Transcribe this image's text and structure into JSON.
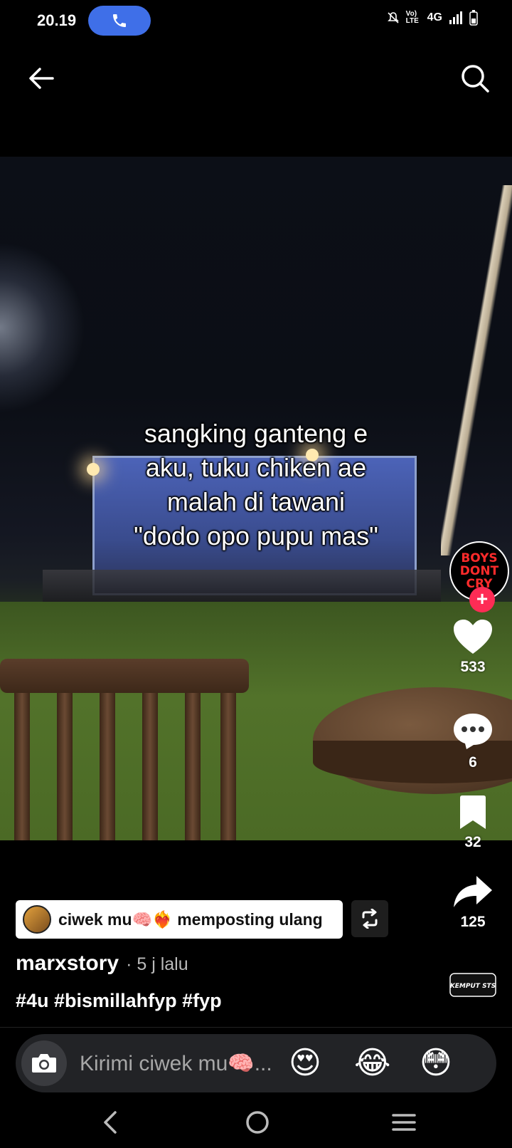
{
  "status_bar": {
    "time": "20.19",
    "network": "4G",
    "volte": "Vo) LTE"
  },
  "top_bar": {
    "back_icon": "arrow-left-icon",
    "search_icon": "search-icon"
  },
  "video": {
    "caption_lines": [
      "sangking ganteng e",
      "aku, tuku chiken ae",
      "malah di tawani",
      "\"dodo opo pupu mas\""
    ]
  },
  "creator_avatar": {
    "logo_lines": [
      "BOYS",
      "DONT",
      "CRY"
    ],
    "follow_label": "+"
  },
  "actions": {
    "likes": "533",
    "comments": "6",
    "saves": "32",
    "shares": "125"
  },
  "repost": {
    "text": "ciwek mu🧠❤️‍🔥 memposting ulang"
  },
  "post": {
    "author": "marxstory",
    "time": "· 5 j lalu",
    "hashtags": "#4u #bismillahfyp #fyp",
    "sound_label": "KEMPUT STS"
  },
  "comment": {
    "placeholder": "Kirimi ciwek mu🧠...",
    "emojis": [
      "😍",
      "😂",
      "😳"
    ]
  },
  "colors": {
    "call_pill": "#3f6fe8",
    "follow": "#fe2c55",
    "background": "#000000"
  }
}
